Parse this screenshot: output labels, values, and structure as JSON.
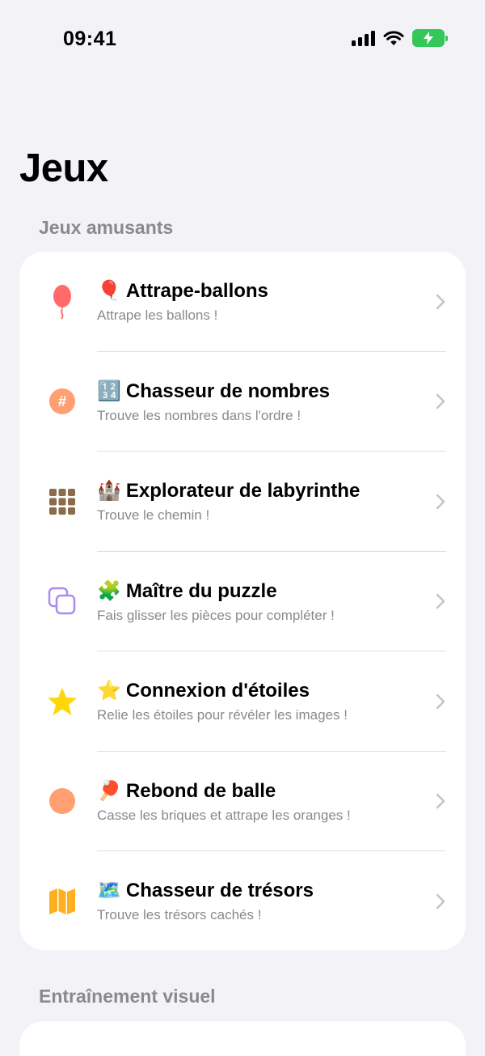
{
  "status_bar": {
    "time": "09:41"
  },
  "page": {
    "title": "Jeux"
  },
  "sections": [
    {
      "header": "Jeux amusants",
      "items": [
        {
          "emoji": "🎈",
          "title": "Attrape-ballons",
          "subtitle": "Attrape les ballons !",
          "icon": "balloon-icon",
          "icon_color": "#ff6b6b"
        },
        {
          "emoji": "🔢",
          "title": "Chasseur de nombres",
          "subtitle": "Trouve les nombres dans l'ordre !",
          "icon": "number-icon",
          "icon_color": "#ff9f72"
        },
        {
          "emoji": "🏰",
          "title": "Explorateur de labyrinthe",
          "subtitle": "Trouve le chemin !",
          "icon": "grid-icon",
          "icon_color": "#8b6b4a"
        },
        {
          "emoji": "🧩",
          "title": "Maître du puzzle",
          "subtitle": "Fais glisser les pièces pour compléter !",
          "icon": "squares-icon",
          "icon_color": "#a98cf0"
        },
        {
          "emoji": "⭐",
          "title": "Connexion d'étoiles",
          "subtitle": "Relie les étoiles pour révéler les images !",
          "icon": "star-icon",
          "icon_color": "#ffd60a"
        },
        {
          "emoji": "🏓",
          "title": "Rebond de balle",
          "subtitle": "Casse les briques et attrape les oranges !",
          "icon": "ball-icon",
          "icon_color": "#ff9f72"
        },
        {
          "emoji": "🗺️",
          "title": "Chasseur de trésors",
          "subtitle": "Trouve les trésors cachés !",
          "icon": "map-icon",
          "icon_color": "#ffb020"
        }
      ]
    },
    {
      "header": "Entraînement visuel",
      "items": []
    }
  ]
}
